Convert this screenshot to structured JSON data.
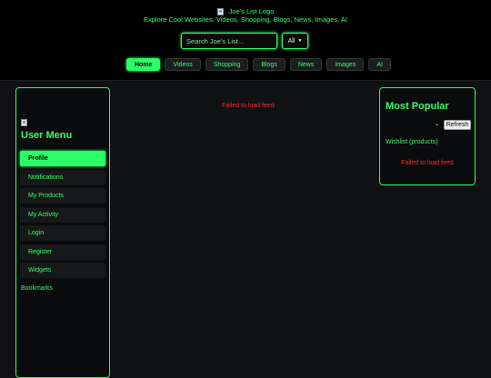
{
  "header": {
    "logo_alt": "Joe's List Logo",
    "tagline": "Explore Cool Websites, Videos, Shopping, Blogs, News, Images, AI",
    "search": {
      "placeholder": "Search Joe's List...",
      "value": ""
    },
    "category_select": {
      "selected": "All"
    },
    "nav": [
      {
        "label": "Home",
        "active": true
      },
      {
        "label": "Videos",
        "active": false
      },
      {
        "label": "Shopping",
        "active": false
      },
      {
        "label": "Blogs",
        "active": false
      },
      {
        "label": "News",
        "active": false
      },
      {
        "label": "Images",
        "active": false
      },
      {
        "label": "AI",
        "active": false
      }
    ]
  },
  "user_menu": {
    "title": "User Menu",
    "items": [
      {
        "label": "Profile",
        "active": true
      },
      {
        "label": "Notifications",
        "active": false
      },
      {
        "label": "My Products",
        "active": false
      },
      {
        "label": "My Activity",
        "active": false
      },
      {
        "label": "Login",
        "active": false
      },
      {
        "label": "Register",
        "active": false
      },
      {
        "label": "Widgets",
        "active": false
      }
    ],
    "bookmarks_label": "Bookmarks"
  },
  "main": {
    "feed_error": "Failed to load feed"
  },
  "most_popular": {
    "title": "Most Popular",
    "refresh_label": "Refresh",
    "wishlist_label": "Wishlist (products)",
    "feed_error": "Failed to load feed"
  },
  "colors": {
    "accent": "#2aff66",
    "text": "#39ff6a",
    "error": "#ff2a2a",
    "background": "#0f1113",
    "header_bg": "#000000"
  }
}
